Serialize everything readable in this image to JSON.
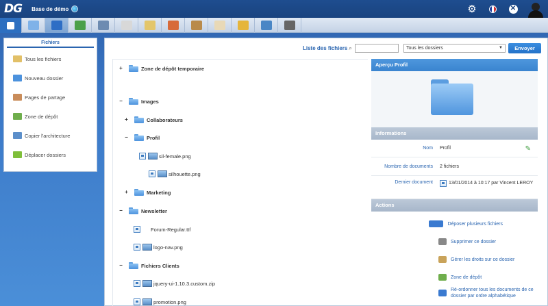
{
  "app": {
    "logo": "DG",
    "database_label": "Base de démo",
    "flag_colors": [
      "#1f3ea0",
      "#ffffff",
      "#d22f2f"
    ]
  },
  "toolbar": {
    "buttons": [
      {
        "name": "dashboard-button",
        "icon": "grid-icon",
        "color": "#ffffff"
      },
      {
        "name": "users-button",
        "icon": "users-icon",
        "color": "#7fb2e8"
      },
      {
        "name": "save-button",
        "icon": "save-icon",
        "color": "#2e6ec5"
      },
      {
        "name": "spreadsheet-button",
        "icon": "spreadsheet-icon",
        "color": "#4aa04a"
      },
      {
        "name": "group-button",
        "icon": "group-icon",
        "color": "#6d8bb1"
      },
      {
        "name": "mail-button",
        "icon": "mail-icon",
        "color": "#d8d8d8"
      },
      {
        "name": "edit-button",
        "icon": "edit-icon",
        "color": "#e3c66b"
      },
      {
        "name": "home-button",
        "icon": "home-icon",
        "color": "#d76a3a"
      },
      {
        "name": "package-button",
        "icon": "package-icon",
        "color": "#b98a4a"
      },
      {
        "name": "document-button",
        "icon": "document-icon",
        "color": "#e8d9b7"
      },
      {
        "name": "coins-button",
        "icon": "coins-icon",
        "color": "#e5b53b"
      },
      {
        "name": "globe-button",
        "icon": "globe-icon",
        "color": "#4a86c5"
      },
      {
        "name": "tools-button",
        "icon": "tools-icon",
        "color": "#666666"
      }
    ]
  },
  "sidebar": {
    "title": "Fichiers",
    "items": [
      {
        "label": "Tous les fichiers",
        "icon": "folder-icon",
        "color": "#e2c068"
      },
      {
        "label": "Nouveau dossier",
        "icon": "new-folder-icon",
        "color": "#4c92dd"
      },
      {
        "label": "Pages de partage",
        "icon": "share-pages-icon",
        "color": "#c98c5a"
      },
      {
        "label": "Zone de dépôt",
        "icon": "dropzone-icon",
        "color": "#6fae4c"
      },
      {
        "label": "Copier l'architecture",
        "icon": "copy-architecture-icon",
        "color": "#5c8fca"
      },
      {
        "label": "Déplacer dossiers",
        "icon": "move-arrow-icon",
        "color": "#7fbf3a"
      }
    ]
  },
  "search": {
    "label": "Liste des fichiers",
    "placeholder": "",
    "scope_selected": "Tous les dossiers",
    "submit_label": "Envoyer"
  },
  "tree": {
    "nodes": [
      {
        "label": "Zone de dépôt temporaire",
        "type": "folder",
        "toggle": "+",
        "bold": true
      },
      {
        "label": "Images",
        "type": "folder",
        "toggle": "−",
        "bold": true
      },
      {
        "label": "Collaborateurs",
        "type": "folder",
        "toggle": "+",
        "bold": true
      },
      {
        "label": "Profil",
        "type": "folder",
        "toggle": "−",
        "bold": true
      },
      {
        "label": "sil-female.png",
        "type": "image",
        "toggle": "",
        "bold": false
      },
      {
        "label": "silhouette.png",
        "type": "image",
        "toggle": "",
        "bold": false
      },
      {
        "label": "Marketing",
        "type": "folder",
        "toggle": "+",
        "bold": true
      },
      {
        "label": "Newsletter",
        "type": "folder",
        "toggle": "−",
        "bold": true
      },
      {
        "label": "Forum-Regular.ttf",
        "type": "file",
        "toggle": "",
        "bold": false
      },
      {
        "label": "logo-nav.png",
        "type": "image",
        "toggle": "",
        "bold": false
      },
      {
        "label": "Fichiers Clients",
        "type": "folder",
        "toggle": "−",
        "bold": true
      },
      {
        "label": "jquery-ui-1.10.3.custom.zip",
        "type": "image",
        "toggle": "",
        "bold": false
      },
      {
        "label": "promotion.png",
        "type": "image",
        "toggle": "",
        "bold": false
      }
    ]
  },
  "preview": {
    "title": "Aperçu Profil",
    "info_title": "Informations",
    "info": [
      {
        "key": "Nom",
        "value": "Profil"
      },
      {
        "key": "Nombre de documents",
        "value": "2 fichiers"
      },
      {
        "key": "Dernier document",
        "value": "13/01/2014 à 10:17 par Vincent LEROY"
      }
    ],
    "actions_title": "Actions",
    "actions": [
      {
        "label": "Déposer plusieurs fichiers",
        "icon": "upload-multiple-icon",
        "color": "#3a7ad0"
      },
      {
        "label": "Supprimer ce dossier",
        "icon": "trash-icon",
        "color": "#888888"
      },
      {
        "label": "Gérer les droits sur ce dossier",
        "icon": "permissions-icon",
        "color": "#c9a35a"
      },
      {
        "label": "Zone de dépôt",
        "icon": "dropzone-icon",
        "color": "#6fae4c"
      },
      {
        "label": "Ré-ordonner tous les documents de ce dossier par ordre alphabétique",
        "icon": "sort-az-icon",
        "color": "#3a7ad0"
      }
    ]
  }
}
